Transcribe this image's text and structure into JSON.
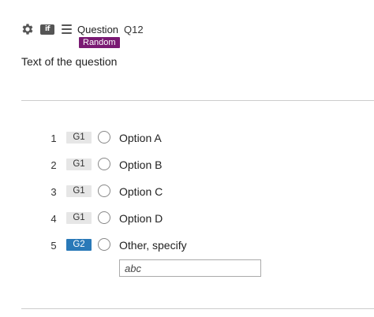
{
  "header": {
    "settings_icon": "gear-icon",
    "logic_icon": "if-icon",
    "logic_icon_text": "if",
    "menu_icon": "menu-icon",
    "label": "Question",
    "question_id": "Q12",
    "badge": "Random"
  },
  "question": {
    "text": "Text of the question"
  },
  "options": [
    {
      "number": "1",
      "group": "G1",
      "label": "Option A"
    },
    {
      "number": "2",
      "group": "G1",
      "label": "Option B"
    },
    {
      "number": "3",
      "group": "G1",
      "label": "Option C"
    },
    {
      "number": "4",
      "group": "G1",
      "label": "Option D"
    },
    {
      "number": "5",
      "group": "G2",
      "label": "Other, specify"
    }
  ],
  "specify": {
    "placeholder": "abc"
  },
  "colors": {
    "badge_bg": "#7a1a73",
    "group_default_bg": "#e6e6e6",
    "group_alt_bg": "#2a79b8"
  }
}
